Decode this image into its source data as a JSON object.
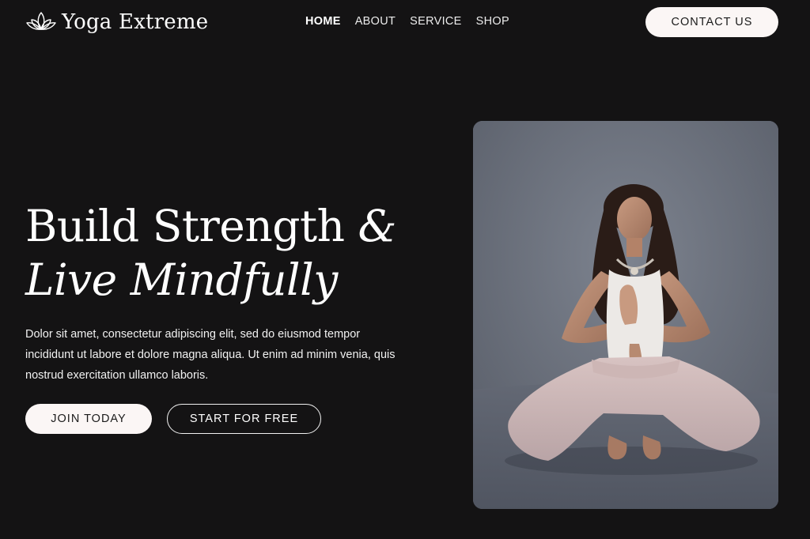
{
  "brand": {
    "name": "Yoga Extreme",
    "logo_icon": "lotus-icon"
  },
  "nav": {
    "items": [
      {
        "label": "HOME",
        "active": true
      },
      {
        "label": "ABOUT",
        "active": false
      },
      {
        "label": "SERVICE",
        "active": false
      },
      {
        "label": "SHOP",
        "active": false
      }
    ]
  },
  "header": {
    "contact_label": "CONTACT US"
  },
  "hero": {
    "title_line1": "Build Strength",
    "title_amp": "&",
    "title_line2": "Live Mindfully",
    "description": "Dolor sit amet, consectetur adipiscing elit, sed do eiusmod tempor incididunt ut labore et dolore magna aliqua. Ut enim ad minim venia, quis nostrud exercitation ullamco laboris.",
    "primary_button": "JOIN TODAY",
    "secondary_button": "START FOR FREE"
  },
  "colors": {
    "background": "#141314",
    "button_light": "#fbf6f5",
    "text": "#ffffff"
  }
}
